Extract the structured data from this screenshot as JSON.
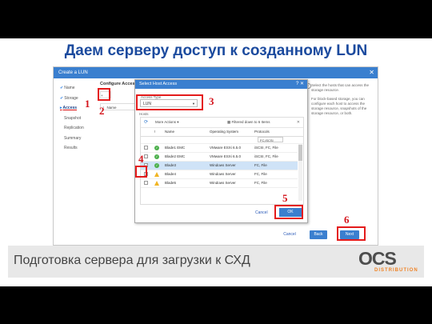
{
  "slide": {
    "title": "Даем серверу доступ к созданному LUN",
    "footer_text": "Подготовка сервера для загрузки к СХД",
    "logo_main": "OCS",
    "logo_sub": "DISTRIBUTION"
  },
  "wizard": {
    "title": "Create a LUN",
    "nav": [
      {
        "label": "Name",
        "checked": true
      },
      {
        "label": "Storage",
        "checked": true
      },
      {
        "label": "Access",
        "checked": false,
        "active": true
      },
      {
        "label": "Snapshot"
      },
      {
        "label": "Replication"
      },
      {
        "label": "Summary"
      },
      {
        "label": "Results"
      }
    ],
    "configure_title": "Configure Access",
    "cfg_row_label": "Name",
    "hint_p1": "Select the hosts that can access the storage resource.",
    "hint_p2": "For block-based storage, you can configure each host to access the storage resource, snapshots of the storage resource, or both.",
    "cancel": "Cancel",
    "back": "Back",
    "next": "Next"
  },
  "modal": {
    "title": "Select Host Access",
    "access_type_label": "Access Type",
    "access_type_value": "LUN",
    "hosts_label": "Hosts",
    "more_actions": "More Actions",
    "filter_status": "Filtered down to 6 Items",
    "columns": {
      "name": "Name",
      "os": "Operating System",
      "protocols": "Protocols"
    },
    "protocol_filter": "FC,iSCSI",
    "rows": [
      {
        "name": "Blade1 EMC",
        "os": "VMware ESXi 6.5.0",
        "protocols": "iSCSI, FC, File",
        "status": "ok",
        "checked": false
      },
      {
        "name": "Blade2 EMC",
        "os": "VMware ESXi 6.5.0",
        "protocols": "iSCSI, FC, File",
        "status": "ok",
        "checked": false
      },
      {
        "name": "Blade3",
        "os": "Windows Server",
        "protocols": "FC, File",
        "status": "ok",
        "checked": true
      },
      {
        "name": "Blade4",
        "os": "Windows Server",
        "protocols": "FC, File",
        "status": "warn",
        "checked": false
      },
      {
        "name": "Blade5",
        "os": "Windows Server",
        "protocols": "FC, File",
        "status": "warn",
        "checked": false
      }
    ],
    "cancel": "Cancel",
    "ok": "OK"
  },
  "annotations": [
    "1",
    "2",
    "3",
    "4",
    "5",
    "6"
  ]
}
